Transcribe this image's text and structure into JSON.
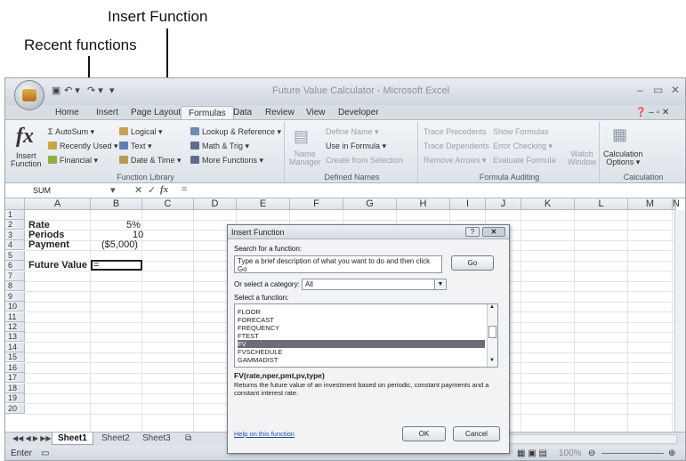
{
  "annotations": {
    "insert_function": "Insert Function",
    "recent_functions": "Recent functions"
  },
  "titlebar": {
    "title": "Future Value Calculator - Microsoft Excel",
    "qat": [
      "↶ ▾",
      "↷ ▾",
      "▾"
    ],
    "window_buttons": [
      "–",
      "▭",
      "✕"
    ]
  },
  "tabs": [
    "Home",
    "Insert",
    "Page Layout",
    "Formulas",
    "Data",
    "Review",
    "View",
    "Developer"
  ],
  "active_tab": "Formulas",
  "ribbon": {
    "function_library": {
      "label": "Function Library",
      "insert_function": "Insert\nFunction",
      "items": [
        "Σ AutoSum ▾",
        "Recently Used ▾",
        "Financial ▾",
        "Logical ▾",
        "Text ▾",
        "Date & Time ▾",
        "Lookup & Reference ▾",
        "Math & Trig ▾",
        "More Functions ▾"
      ]
    },
    "defined_names": {
      "label": "Defined Names",
      "name_manager": "Name\nManager",
      "items": [
        "Define Name ▾",
        "Use in Formula ▾",
        "Create from Selection"
      ]
    },
    "formula_auditing": {
      "label": "Formula Auditing",
      "items": [
        "Trace Precedents",
        "Trace Dependents",
        "Remove Arrows ▾",
        "Show Formulas",
        "Error Checking ▾",
        "Evaluate Formula"
      ],
      "watch_window": "Watch\nWindow"
    },
    "calculation": {
      "label": "Calculation",
      "options": "Calculation\nOptions ▾"
    }
  },
  "formula_bar": {
    "name_box": "SUM",
    "cancel": "✕",
    "enter": "✓",
    "fx": "fx",
    "content": "="
  },
  "columns": [
    "A",
    "B",
    "C",
    "D",
    "E",
    "F",
    "G",
    "H",
    "I",
    "J",
    "K",
    "L",
    "M",
    "N",
    "C"
  ],
  "rows": [
    "1",
    "2",
    "3",
    "4",
    "5",
    "6",
    "7",
    "8",
    "9",
    "10",
    "11",
    "12",
    "13",
    "14",
    "15",
    "16",
    "17",
    "18",
    "19",
    "20"
  ],
  "cells": {
    "a2": "Rate",
    "b2": "5%",
    "a3": "Periods",
    "b3": "10",
    "a4": "Payment",
    "b4": "($5,000)",
    "a6": "Future Value",
    "b6": "="
  },
  "dialog": {
    "title": "Insert Function",
    "help_btn": "?",
    "close_btn": "✕",
    "search_label": "Search for a function:",
    "search_value": "Type a brief description of what you want to do and then click Go",
    "go_button": "Go",
    "category_label": "Or select a category:",
    "category_value": "All",
    "select_label": "Select a function:",
    "functions": [
      "FLOOR",
      "FORECAST",
      "FREQUENCY",
      "FTEST",
      "FV",
      "FVSCHEDULE",
      "GAMMADIST"
    ],
    "selected_function": "FV",
    "syntax": "FV(rate,nper,pmt,pv,type)",
    "description": "Returns the future value of an investment based on periodic, constant payments and a constant interest rate.",
    "help_link": "Help on this function",
    "ok": "OK",
    "cancel": "Cancel"
  },
  "sheet_tabs": [
    "Sheet1",
    "Sheet2",
    "Sheet3"
  ],
  "status": {
    "mode": "Enter",
    "zoom": "100%"
  }
}
